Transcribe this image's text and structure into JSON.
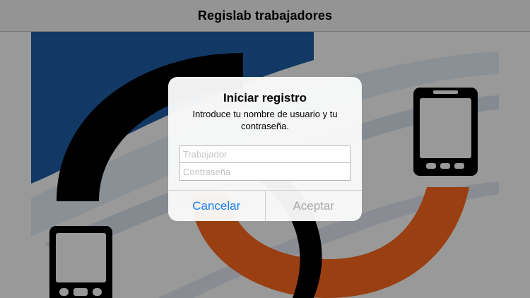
{
  "navbar": {
    "title": "Regislab trabajadores"
  },
  "alert": {
    "title": "Iniciar registro",
    "message": "Introduce tu nombre de usuario y tu contraseña.",
    "username_placeholder": "Trabajador",
    "username_value": "",
    "password_placeholder": "Contraseña",
    "password_value": "",
    "cancel_label": "Cancelar",
    "accept_label": "Aceptar",
    "accept_enabled": false
  },
  "colors": {
    "button_blue": "#1a7cf5",
    "button_disabled": "#a8a8ad",
    "logo_blue": "#1f5fa8",
    "logo_orange": "#ff6a1e",
    "logo_black": "#000000"
  }
}
